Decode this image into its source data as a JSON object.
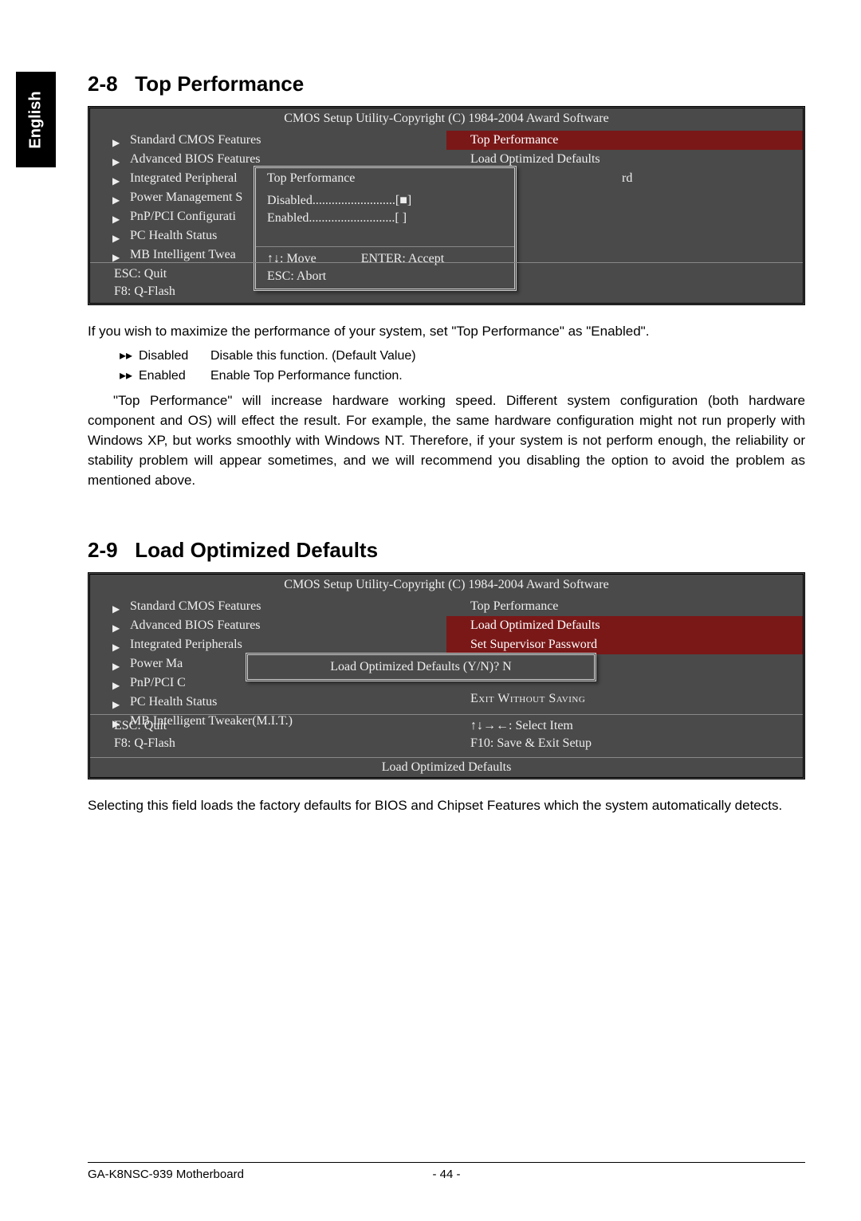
{
  "sidebar": {
    "language": "English"
  },
  "section1": {
    "number": "2-8",
    "title": "Top Performance",
    "bios": {
      "header": "CMOS Setup Utility-Copyright (C) 1984-2004 Award Software",
      "left_items": [
        "Standard CMOS Features",
        "Advanced BIOS Features",
        "Integrated Peripheral",
        "Power Management S",
        "PnP/PCI Configurati",
        "PC Health Status",
        "MB Intelligent Twea"
      ],
      "right_items": [
        "Top Performance",
        "Load Optimized Defaults"
      ],
      "right_trailing": "rd",
      "footer_left": [
        "ESC: Quit",
        "F8: Q-Flash"
      ],
      "popup": {
        "title": "Top Performance",
        "options": [
          {
            "label": "Disabled",
            "dots": "..........................",
            "mark": "[■]"
          },
          {
            "label": "Enabled",
            "dots": "...........................",
            "mark": "[  ]"
          }
        ],
        "footer1": "↑↓: Move",
        "footer2": "ENTER: Accept",
        "footer3": "ESC: Abort"
      }
    },
    "intro": "If you wish to maximize the performance of your system, set \"Top Performance\" as \"Enabled\".",
    "options": [
      {
        "name": "Disabled",
        "desc": "Disable this function. (Default Value)"
      },
      {
        "name": "Enabled",
        "desc": "Enable Top Performance function."
      }
    ],
    "paragraph": "\"Top Performance\" will increase hardware working speed. Different system configuration (both hardware component and OS) will effect the result. For example, the same hardware configuration might not run properly with Windows XP, but works smoothly with Windows NT.  Therefore, if your system is not perform enough, the reliability or stability problem will appear sometimes, and we will recommend you disabling the option to avoid the problem as mentioned above."
  },
  "section2": {
    "number": "2-9",
    "title": "Load Optimized Defaults",
    "bios": {
      "header": "CMOS Setup Utility-Copyright (C) 1984-2004 Award Software",
      "left_items": [
        "Standard CMOS Features",
        "Advanced BIOS Features",
        "Integrated Peripherals",
        "Power Ma",
        "PnP/PCI C",
        "PC Health Status",
        "MB Intelligent Tweaker(M.I.T.)"
      ],
      "right_items": [
        "Top Performance",
        "Load Optimized Defaults",
        "Set Supervisor Password",
        "",
        "",
        "Exit Without Saving"
      ],
      "footer_left": [
        "ESC: Quit",
        "F8: Q-Flash"
      ],
      "footer_right": [
        "↑↓→←: Select Item",
        "F10: Save & Exit Setup"
      ],
      "status": "Load Optimized Defaults",
      "popup_text": "Load Optimized Defaults (Y/N)? N"
    },
    "paragraph": "Selecting this field loads the factory defaults for BIOS and Chipset Features which the system automatically detects."
  },
  "footer": {
    "product": "GA-K8NSC-939 Motherboard",
    "page": "- 44 -"
  }
}
